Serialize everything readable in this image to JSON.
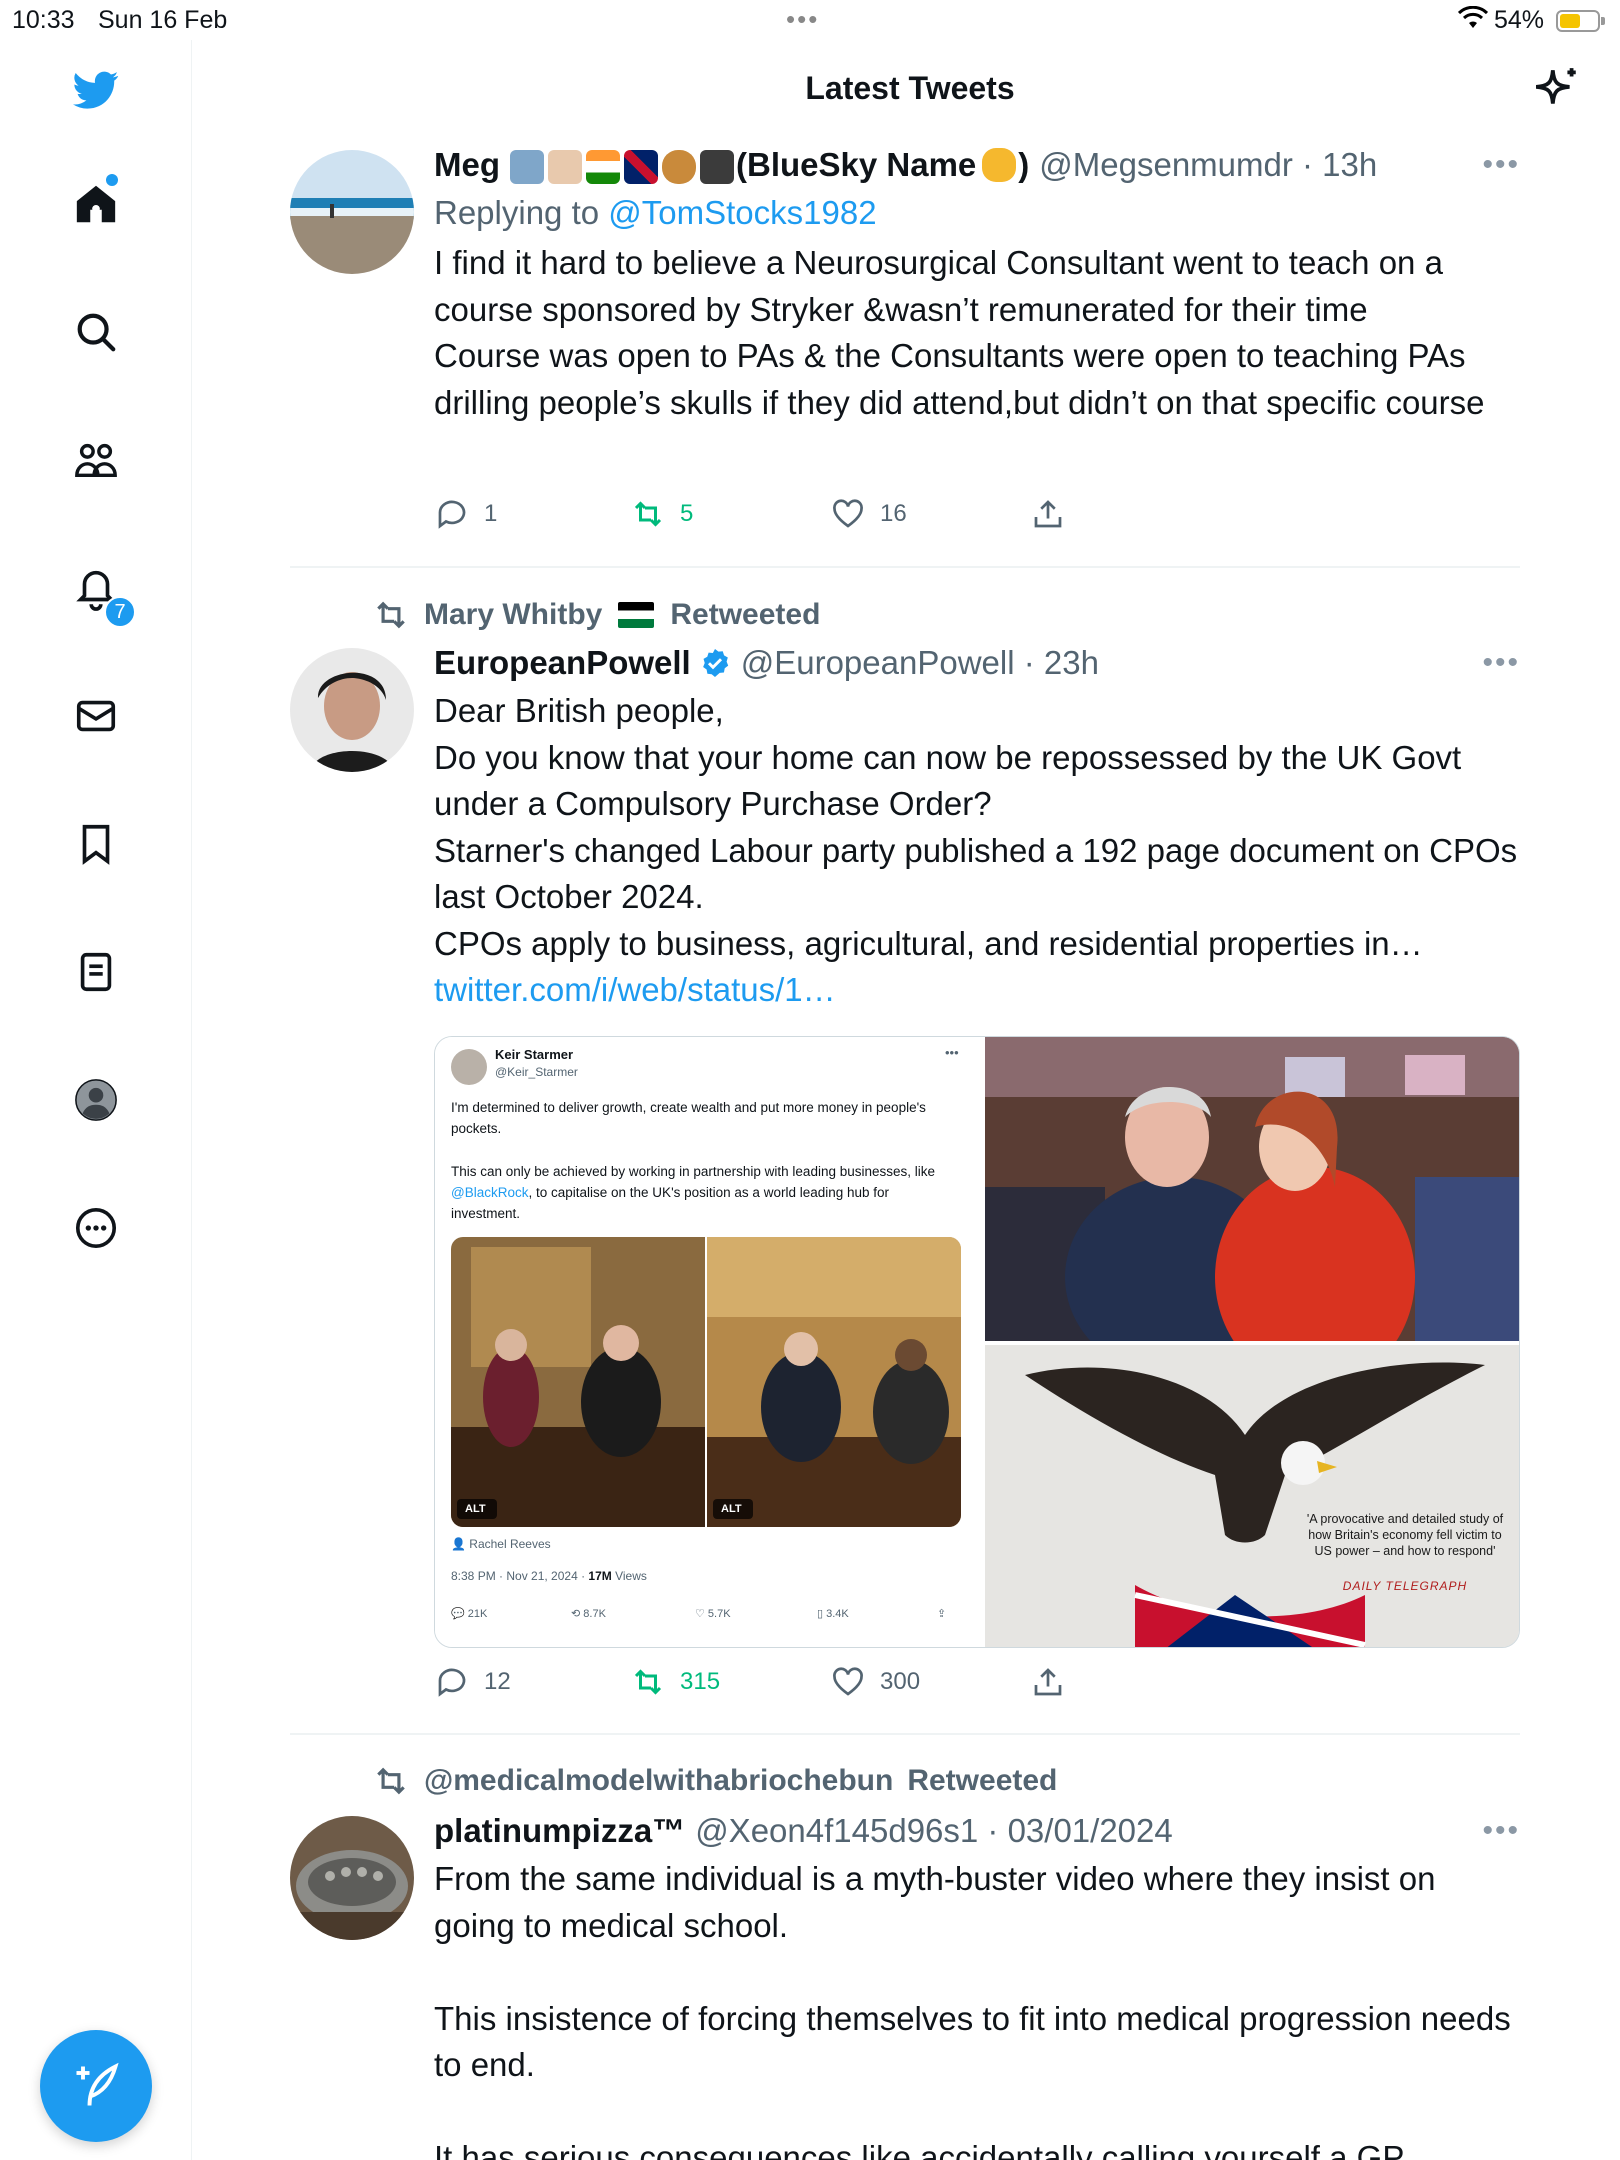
{
  "status_bar": {
    "time": "10:33",
    "date": "Sun 16 Feb",
    "battery": "54%"
  },
  "header": {
    "title": "Latest Tweets"
  },
  "sidebar": {
    "notification_count": "7"
  },
  "tweets": [
    {
      "name": "Meg",
      "name_suffix": "(BlueSky Name",
      "name_close": ")",
      "handle": "@Megsenmumdr · 13h",
      "replying_label": "Replying to",
      "replying_to": "@TomStocks1982",
      "text": "I find it hard to believe a Neurosurgical Consultant went to teach on a course sponsored by Stryker &wasn’t remunerated for their time\nCourse was open to PAs & the Consultants were open to teaching PAs drilling people’s skulls if they did attend,but didn’t on that specific course",
      "replies": "1",
      "retweets": "5",
      "likes": "16"
    },
    {
      "retweeted_by": "Mary Whitby",
      "retweeted_label": "Retweeted",
      "name": "EuropeanPowell",
      "handle": "@EuropeanPowell · 23h",
      "text": "Dear British people,\nDo you know that your home can now be repossessed by the UK Govt under a Compulsory Purchase Order?\nStarner's changed Labour party published a 192 page document on CPOs last October 2024.\nCPOs apply to business, agricultural, and residential properties in…",
      "link": "twitter.com/i/web/status/1…",
      "replies": "12",
      "retweets": "315",
      "likes": "300",
      "quoted_screenshot": {
        "name": "Keir Starmer",
        "handle": "@Keir_Starmer",
        "para1": "I'm determined to deliver growth, create wealth and put more money in people's pockets.",
        "para2_a": "This can only be achieved by working in partnership with leading businesses, like ",
        "para2_link": "@BlackRock",
        "para2_b": ", to capitalise on the UK's position as a world leading hub for investment.",
        "alt": "ALT",
        "tagged": "Rachel Reeves",
        "meta": "8:38 PM · Nov 21, 2024 · ",
        "views": "17M",
        "views_label": " Views",
        "replies": "21K",
        "retweets": "8.7K",
        "likes": "5.7K",
        "bookmarks": "3.4K"
      },
      "book_cover": {
        "quote": "'A provocative and detailed study of how Britain's economy fell victim to US power – and how to respond'",
        "source": "DAILY TELEGRAPH"
      }
    },
    {
      "retweeted_by": "@medicalmodelwithabriochebun",
      "retweeted_label": "Retweeted",
      "name": "platinumpizza™",
      "handle": "@Xeon4f145d96s1 · 03/01/2024",
      "text": "From the same individual is a myth-buster video where they insist on going to medical school.\n\nThis insistence of forcing themselves to fit into medical progression needs to end.\n\nIt has serious consequences like accidentally calling yourself a GP"
    }
  ],
  "icons": {
    "brand": "twitter-bird-icon",
    "sidebar": [
      "home-icon",
      "search-icon",
      "communities-icon",
      "notifications-icon",
      "messages-icon",
      "bookmarks-icon",
      "lists-icon",
      "profile-icon",
      "more-icon"
    ],
    "compose": "compose-icon",
    "header": "sparkle-icon"
  },
  "colors": {
    "accent": "#1d9bf0",
    "retweet": "#00ba7c",
    "secondary_text": "#536471"
  }
}
